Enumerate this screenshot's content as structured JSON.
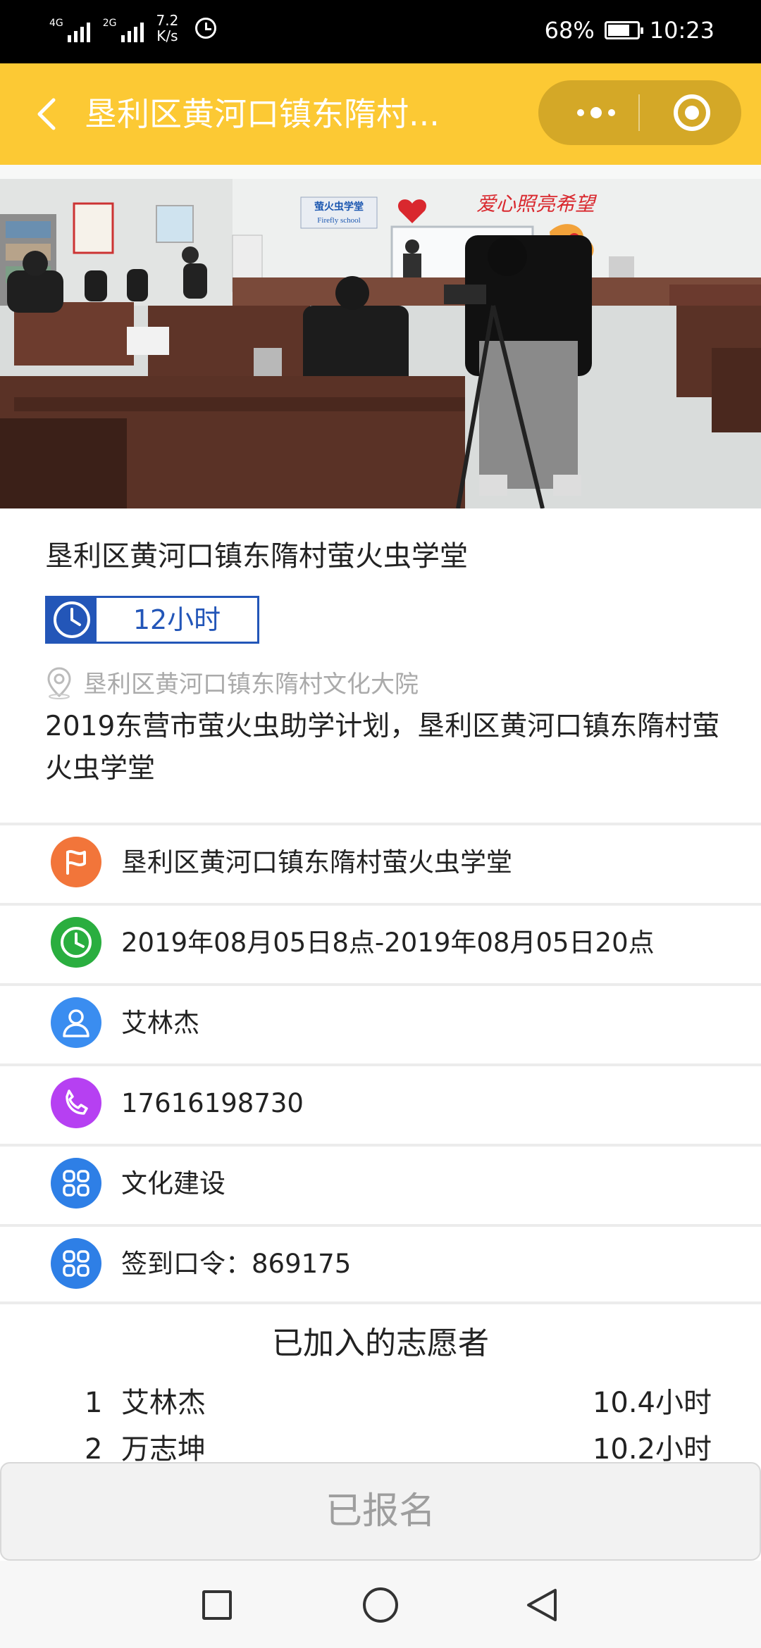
{
  "status_bar": {
    "net1": "4G",
    "net2": "2G",
    "speed_value": "7.2",
    "speed_unit": "K/s",
    "battery_pct": "68%",
    "battery_level": 0.68,
    "time": "10:23"
  },
  "navbar": {
    "title": "垦利区黄河口镇东隋村...",
    "accent_color": "#fcc934"
  },
  "activity": {
    "title": "垦利区黄河口镇东隋村萤火虫学堂",
    "hours": "12小时",
    "address": "垦利区黄河口镇东隋村文化大院",
    "description": "2019东营市萤火虫助学计划，垦利区黄河口镇东隋村萤火虫学堂"
  },
  "photo": {
    "sign1_line1": "萤火虫学堂",
    "sign1_line2": "Firefly school",
    "slogan": "爱心照亮希望"
  },
  "details": [
    {
      "icon": "flag-icon",
      "color": "#f2753a",
      "text": "垦利区黄河口镇东隋村萤火虫学堂"
    },
    {
      "icon": "clock-icon",
      "color": "#2aae3f",
      "text": "2019年08月05日8点-2019年08月05日20点"
    },
    {
      "icon": "person-icon",
      "color": "#3a8df0",
      "text": "艾林杰"
    },
    {
      "icon": "phone-icon",
      "color": "#b640f2",
      "text": "17616198730"
    },
    {
      "icon": "grid-icon",
      "color": "#2e7fe6",
      "text": "文化建设"
    },
    {
      "icon": "grid-icon",
      "color": "#2e7fe6",
      "text": "签到口令：869175"
    }
  ],
  "volunteers": {
    "title": "已加入的志愿者",
    "items": [
      {
        "no": "1",
        "name": "艾林杰",
        "hours": "10.4小时"
      },
      {
        "no": "2",
        "name": "万志坤",
        "hours": "10.2小时"
      }
    ]
  },
  "bottom_button": {
    "label": "已报名"
  }
}
